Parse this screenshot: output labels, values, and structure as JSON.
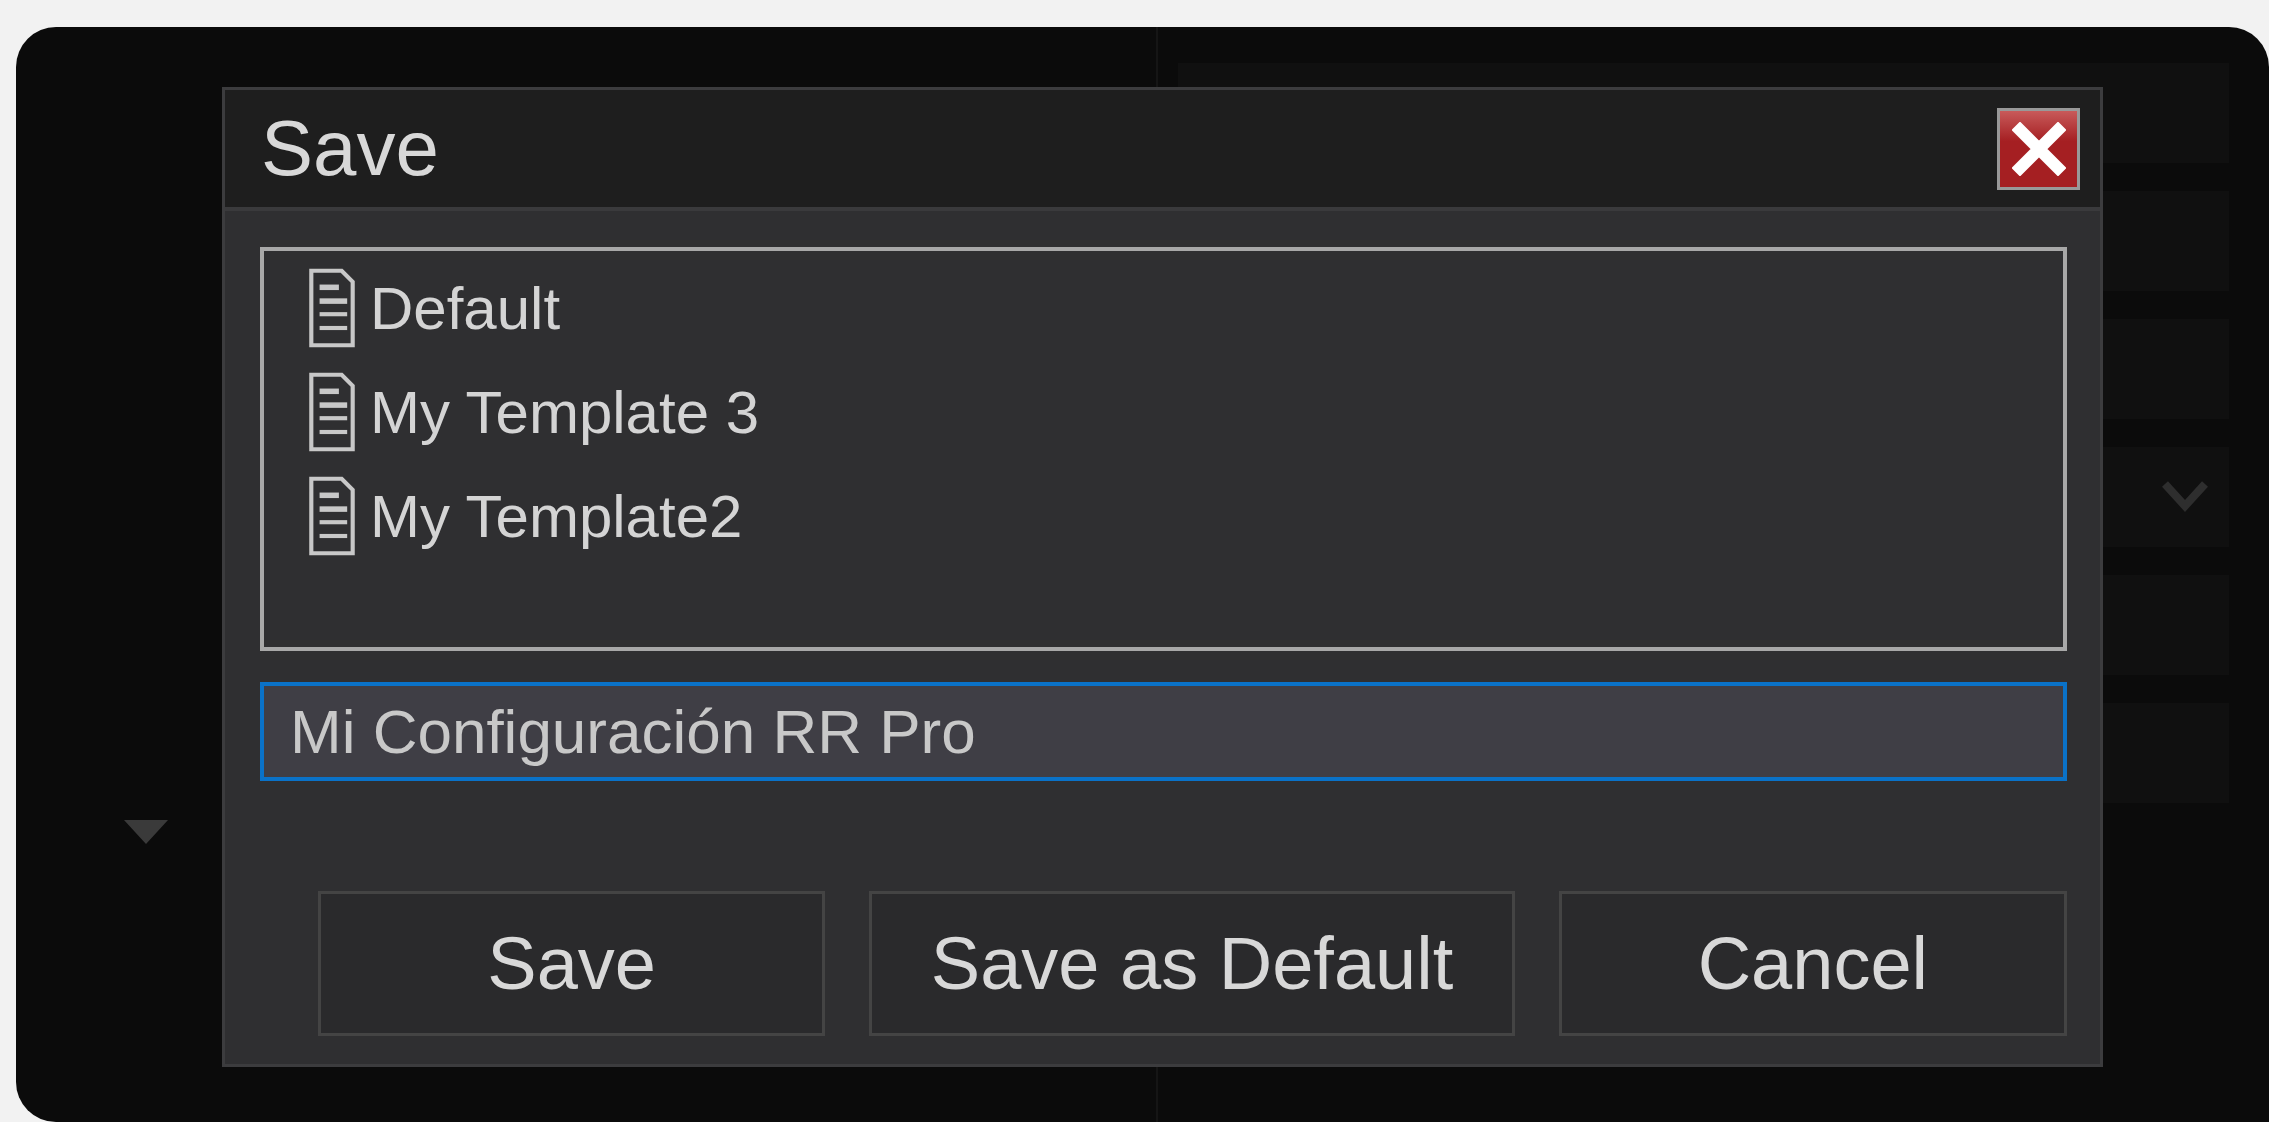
{
  "dialog": {
    "title": "Save",
    "templates": [
      {
        "name": "Default"
      },
      {
        "name": "My Template 3"
      },
      {
        "name": "My Template2"
      }
    ],
    "name_field": {
      "value": "Mi Configuración RR Pro"
    },
    "buttons": [
      "Save",
      "Save as Default",
      "Cancel"
    ]
  }
}
